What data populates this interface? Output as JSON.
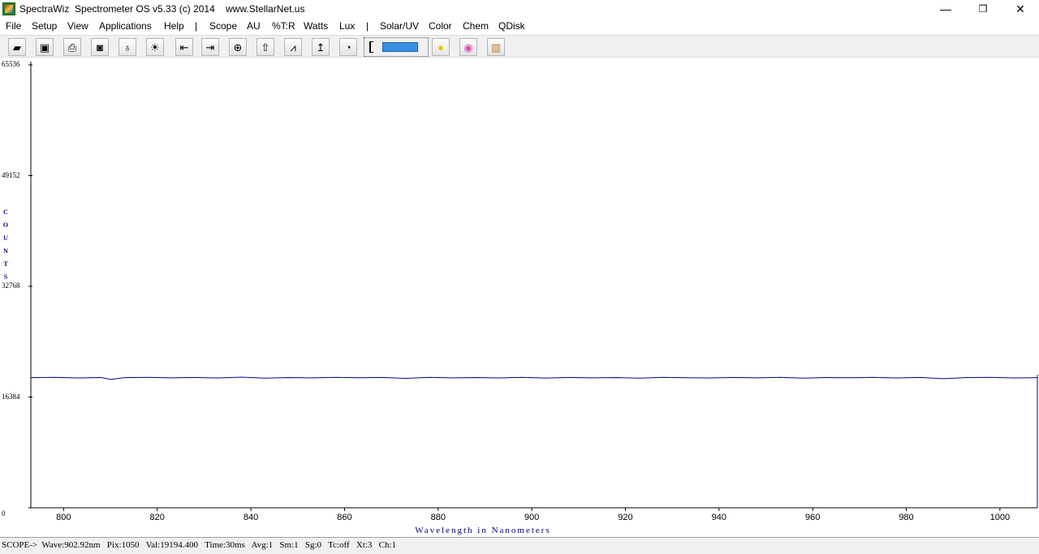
{
  "window": {
    "title": "SpectraWiz  Spectrometer OS v5.33 (c) 2014    www.StellarNet.us",
    "minimize": "—",
    "maximize": "❐",
    "close": "✕"
  },
  "menu": [
    {
      "name": "menu-file",
      "label": "File"
    },
    {
      "name": "menu-setup",
      "label": "Setup"
    },
    {
      "name": "menu-view",
      "label": "View"
    },
    {
      "name": "menu-applications",
      "label": "Applications"
    },
    {
      "name": "menu-help",
      "label": "Help"
    },
    {
      "name": "menu-separator-1",
      "label": "|"
    },
    {
      "name": "menu-scope",
      "label": "Scope"
    },
    {
      "name": "menu-au",
      "label": "AU"
    },
    {
      "name": "menu-percent-t-r",
      "label": "%T:R"
    },
    {
      "name": "menu-watts",
      "label": "Watts"
    },
    {
      "name": "menu-lux",
      "label": "Lux"
    },
    {
      "name": "menu-separator-2",
      "label": "|"
    },
    {
      "name": "menu-solar-uv",
      "label": "Solar/UV"
    },
    {
      "name": "menu-color",
      "label": "Color"
    },
    {
      "name": "menu-chem",
      "label": "Chem"
    },
    {
      "name": "menu-qdisk",
      "label": "QDisk"
    }
  ],
  "toolbar": [
    {
      "name": "open-file-icon",
      "glyph": "▰"
    },
    {
      "name": "save-icon",
      "glyph": "▣"
    },
    {
      "name": "print-icon",
      "glyph": "⎙"
    },
    {
      "name": "camera-icon",
      "glyph": "◙"
    },
    {
      "name": "lamp-dark-icon",
      "glyph": "♁"
    },
    {
      "name": "lamp-light-icon",
      "glyph": "☀"
    },
    {
      "name": "cursor-left-icon",
      "glyph": "⇤"
    },
    {
      "name": "cursor-right-icon",
      "glyph": "⇥"
    },
    {
      "name": "zoom-icon",
      "glyph": "⊕"
    },
    {
      "name": "autoscale-icon",
      "glyph": "⇧"
    },
    {
      "name": "peak-icon",
      "glyph": "⩘"
    },
    {
      "name": "scale-up-icon",
      "glyph": "↥"
    },
    {
      "name": "timer-icon",
      "glyph": "◔"
    }
  ],
  "toolbar_right": [
    {
      "name": "solar-icon",
      "glyph": "●",
      "color": "#f2c200"
    },
    {
      "name": "color-wheel-icon",
      "glyph": "◉",
      "color": "#d94fb0"
    },
    {
      "name": "chart-icon",
      "glyph": "▥",
      "color": "#c07a2a"
    }
  ],
  "plot": {
    "ylabel_letters": [
      "C",
      "O",
      "U",
      "N",
      "T",
      "S"
    ],
    "xlabel": "Wavelength in Nanometers",
    "trace_color": "#00008b"
  },
  "chart_data": {
    "type": "line",
    "title": "",
    "xlabel": "Wavelength in Nanometers",
    "ylabel": "COUNTS",
    "xlim": [
      793,
      1008
    ],
    "ylim": [
      0,
      65536
    ],
    "xticks": [
      800,
      820,
      840,
      860,
      880,
      900,
      920,
      940,
      960,
      980,
      1000
    ],
    "yticks": [
      0,
      16384,
      32768,
      49152,
      65536
    ],
    "grid": false,
    "series": [
      {
        "x": [
          793,
          798,
          803,
          808,
          810,
          813,
          818,
          823,
          828,
          833,
          838,
          843,
          848,
          853,
          858,
          863,
          868,
          873,
          878,
          883,
          888,
          893,
          898,
          903,
          908,
          913,
          918,
          923,
          928,
          933,
          938,
          943,
          948,
          953,
          958,
          963,
          968,
          973,
          978,
          983,
          988,
          993,
          998,
          1003,
          1008
        ],
        "values": [
          19250,
          19300,
          19200,
          19280,
          19000,
          19250,
          19300,
          19220,
          19280,
          19200,
          19320,
          19180,
          19260,
          19220,
          19300,
          19240,
          19280,
          19150,
          19300,
          19220,
          19260,
          19200,
          19300,
          19194,
          19280,
          19220,
          19260,
          19180,
          19300,
          19240,
          19200,
          19280,
          19220,
          19300,
          19180,
          19260,
          19240,
          19300,
          19200,
          19280,
          19100,
          19260,
          19300,
          19200,
          19250
        ]
      }
    ]
  },
  "status": {
    "text": "SCOPE->  Wave:902.92nm   Pix:1050   Val:19194.400   Time:30ms   Avg:1   Sm:1   Sg:0   Tc:off   Xt:3   Ch:1"
  }
}
